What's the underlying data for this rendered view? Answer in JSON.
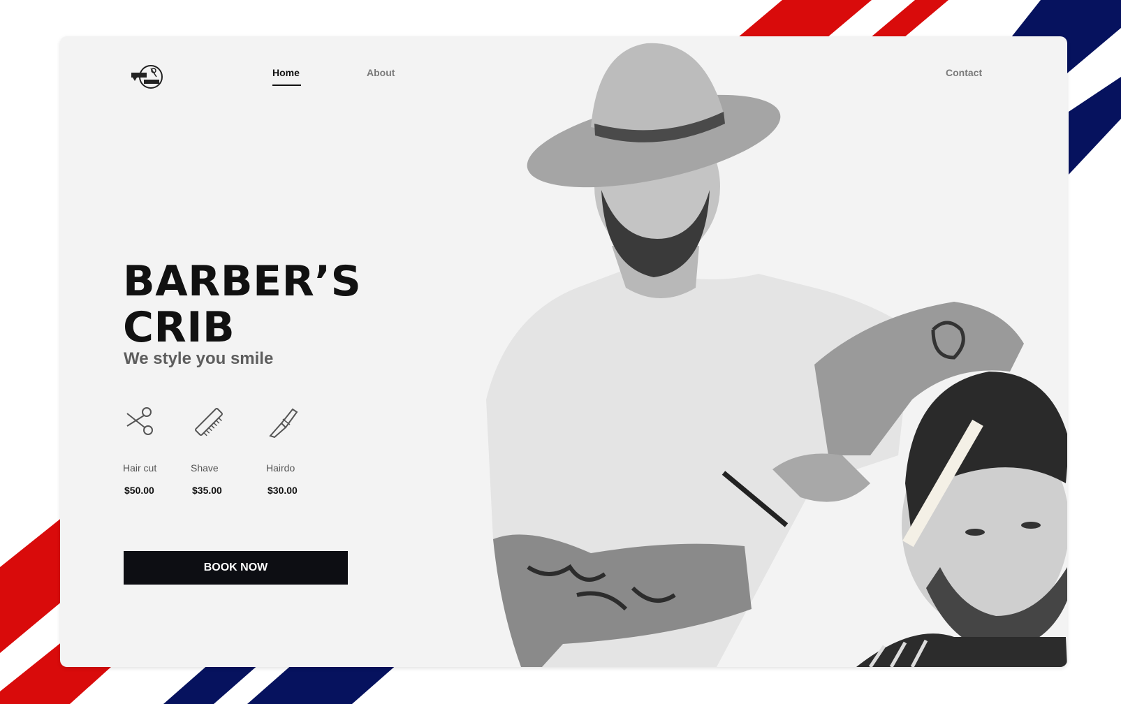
{
  "nav": {
    "logo_alt": "Barber Shop logo",
    "items": [
      {
        "label": "Home",
        "active": true
      },
      {
        "label": "About",
        "active": false
      },
      {
        "label": "Contact",
        "active": false
      }
    ]
  },
  "hero": {
    "title_line1": "BARBER’S",
    "title_line2": "CRIB",
    "tagline": "We style you smile"
  },
  "services": [
    {
      "name": "Hair cut",
      "price": "$50.00",
      "icon": "scissors-icon"
    },
    {
      "name": "Shave",
      "price": "$35.00",
      "icon": "comb-icon"
    },
    {
      "name": "Hairdo",
      "price": "$30.00",
      "icon": "straight-razor-icon"
    }
  ],
  "cta": {
    "label": "BOOK NOW"
  },
  "colors": {
    "stripe_red": "#d90b0b",
    "stripe_blue": "#06125e",
    "card_bg": "#f3f3f3",
    "button_bg": "#0d0e13",
    "text_dark": "#111111"
  }
}
